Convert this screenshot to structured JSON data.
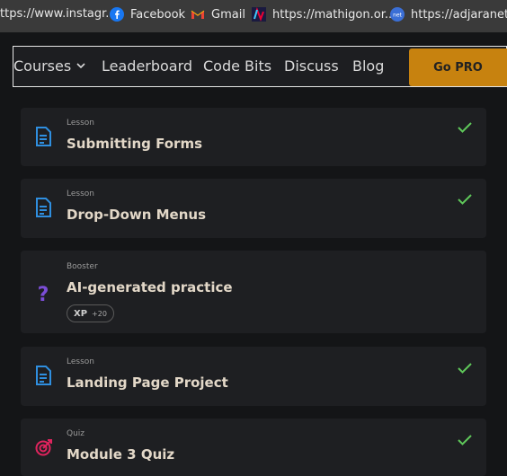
{
  "bookmarks": [
    {
      "label": "ttps://www.instagr..."
    },
    {
      "label": "Facebook"
    },
    {
      "label": "Gmail"
    },
    {
      "label": "https://mathigon.or..."
    },
    {
      "label": "https://adjaranet.to/"
    }
  ],
  "nav": {
    "courses": "Courses",
    "leaderboard": "Leaderboard",
    "codebits": "Code Bits",
    "discuss": "Discuss",
    "blog": "Blog",
    "go_pro": "Go PRO"
  },
  "items": [
    {
      "kind": "Lesson",
      "title": "Submitting Forms",
      "completed": true
    },
    {
      "kind": "Lesson",
      "title": "Drop-Down Menus",
      "completed": true
    },
    {
      "kind": "Booster",
      "title": "AI-generated practice",
      "xp_label": "XP",
      "xp_value": "+20",
      "completed": false
    },
    {
      "kind": "Lesson",
      "title": "Landing Page Project",
      "completed": true
    },
    {
      "kind": "Quiz",
      "title": "Module 3 Quiz",
      "completed": true
    }
  ],
  "colors": {
    "accent": "#c7820f",
    "check": "#5fc85a",
    "lesson_icon": "#2f8fe0",
    "booster_icon": "#7b4dd6",
    "quiz_icon": "#e0245e"
  }
}
